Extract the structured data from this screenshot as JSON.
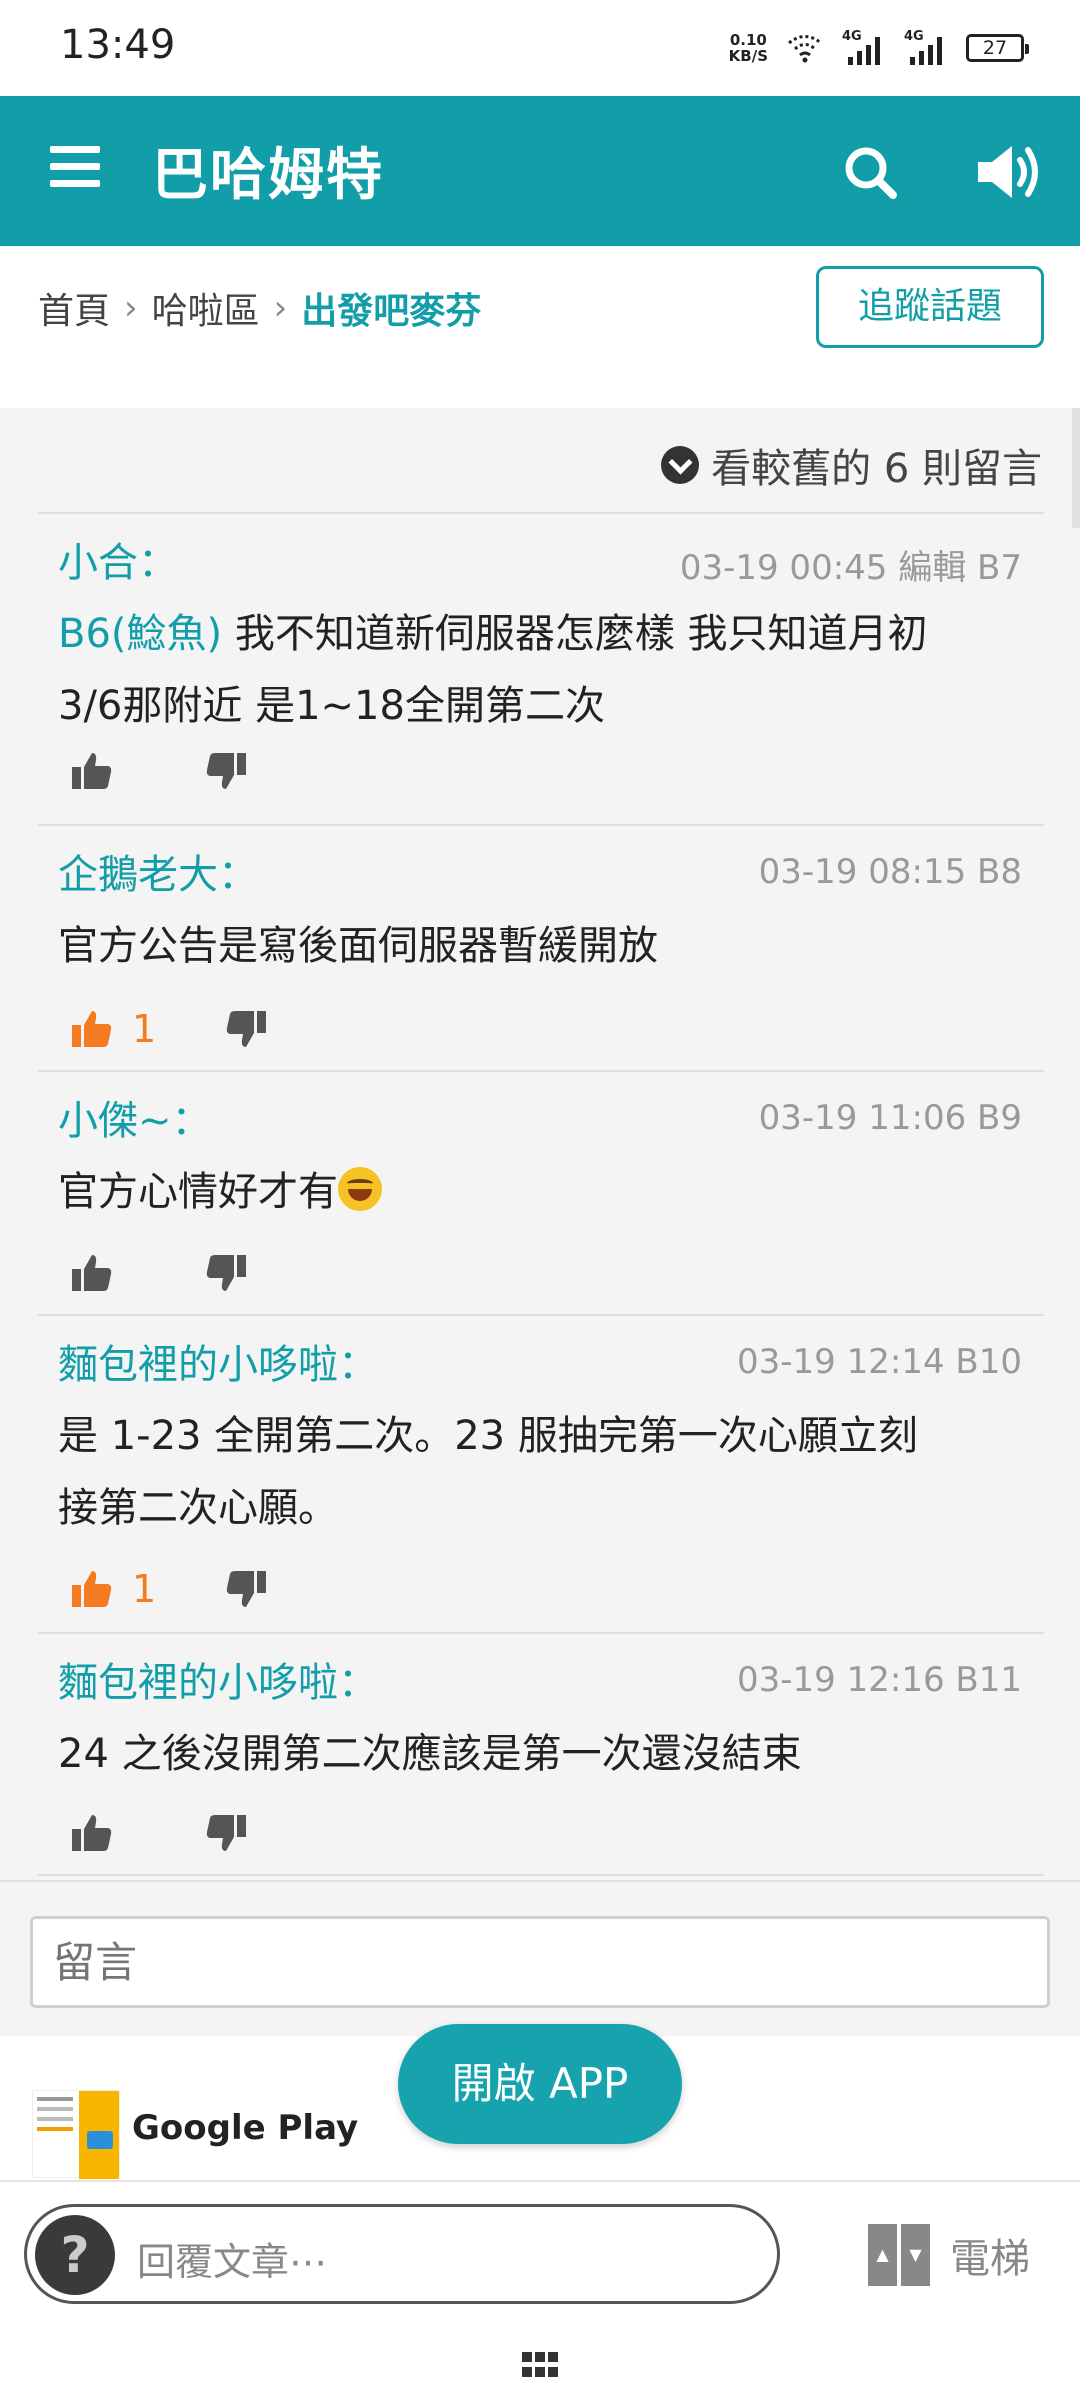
{
  "status_bar": {
    "time": "13:49",
    "net_speed_value": "0.10",
    "net_speed_unit": "KB/S",
    "sim1_label": "4G",
    "sim2_label": "4G",
    "battery": "27"
  },
  "header": {
    "title": "巴哈姆特",
    "icons": [
      "menu-icon",
      "search-icon",
      "speaker-icon"
    ]
  },
  "breadcrumb": {
    "items": [
      "首頁",
      "哈啦區",
      "出發吧麥芬"
    ]
  },
  "follow_button": "追蹤話題",
  "older_comments": "看較舊的 6 則留言",
  "comments": [
    {
      "author": "小合：",
      "meta": "03-19 00:45 編輯  B7",
      "mention": "B6(鯰魚)",
      "body_line1": " 我不知道新伺服器怎麼樣 我只知道月初",
      "body_line2": "3/6那附近 是1~18全開第二次",
      "likes": ""
    },
    {
      "author": "企鵝老大：",
      "meta": "03-19 08:15  B8",
      "body_line1": "官方公告是寫後面伺服器暫緩開放",
      "likes": "1"
    },
    {
      "author": "小傑~：",
      "meta": "03-19 11:06  B9",
      "body_line1": "官方心情好才有",
      "likes": ""
    },
    {
      "author": "麵包裡的小哆啦：",
      "meta": "03-19 12:14  B10",
      "body_line1": "是 1-23 全開第二次。23 服抽完第一次心願立刻",
      "body_line2": "接第二次心願。",
      "likes": "1"
    },
    {
      "author": "麵包裡的小哆啦：",
      "meta": "03-19 12:16  B11",
      "body_line1": "24 之後沒開第二次應該是第一次還沒結束",
      "likes": ""
    }
  ],
  "comment_input": {
    "placeholder": "留言"
  },
  "open_app_button": "開啟 APP",
  "ad": {
    "title": "Google Play"
  },
  "reply_bar": {
    "avatar_glyph": "?",
    "placeholder": "回覆文章⋯",
    "elevator_label": "電梯"
  },
  "colors": {
    "brand": "#119ea8",
    "like_active": "#f47b20",
    "background": "#f4f4f4"
  }
}
